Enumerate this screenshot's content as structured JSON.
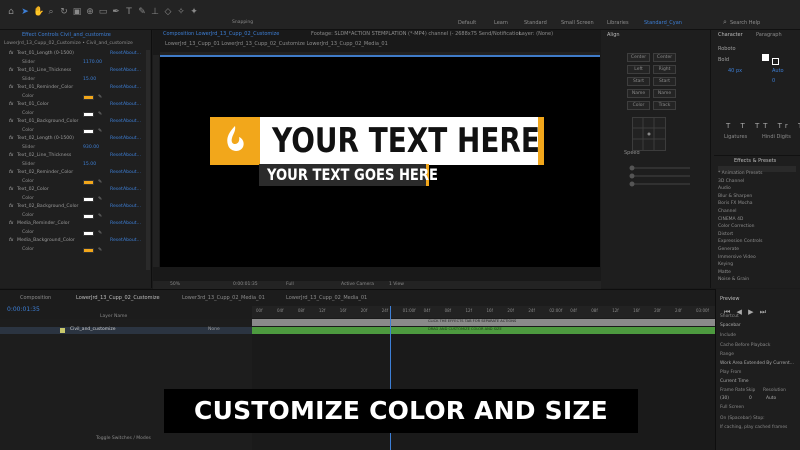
{
  "toolbar": {
    "workspaces": [
      "Default",
      "Learn",
      "Standard",
      "Small Screen",
      "Libraries",
      "Standard_Cyan"
    ],
    "snapping": "Snapping",
    "search": "Search Help"
  },
  "effect_controls": {
    "tab": "Effect Controls Civil_and_customize",
    "layer": "LowerJrd_13_Cupp_02_Customize • Civil_and_customize",
    "rows": [
      {
        "label": "Text_01_Length (0-1500)",
        "reset": "Reset",
        "about": "About..."
      },
      {
        "sub": "Slider",
        "value": "1170.00"
      },
      {
        "label": "Text_01_Line_Thickness",
        "reset": "Reset",
        "about": "About..."
      },
      {
        "sub": "Slider",
        "value": "15.00"
      },
      {
        "label": "Text_01_Reminder_Color",
        "reset": "Reset",
        "about": "About..."
      },
      {
        "sub": "Color",
        "swatch": "#f2a71b"
      },
      {
        "label": "Text_01_Color",
        "reset": "Reset",
        "about": "About..."
      },
      {
        "sub": "Color",
        "swatch": "#ffffff"
      },
      {
        "label": "Text_01_Background_Color",
        "reset": "Reset",
        "about": "About..."
      },
      {
        "sub": "Color",
        "swatch": "#ffffff"
      },
      {
        "label": "Text_02_Length (0-1500)",
        "reset": "Reset",
        "about": "About..."
      },
      {
        "sub": "Slider",
        "value": "930.00"
      },
      {
        "label": "Text_02_Line_Thickness",
        "reset": "Reset",
        "about": "About..."
      },
      {
        "sub": "Slider",
        "value": "15.00"
      },
      {
        "label": "Text_02_Reminder_Color",
        "reset": "Reset",
        "about": "About..."
      },
      {
        "sub": "Color",
        "swatch": "#f2a71b"
      },
      {
        "label": "Text_02_Color",
        "reset": "Reset",
        "about": "About..."
      },
      {
        "sub": "Color",
        "swatch": "#ffffff"
      },
      {
        "label": "Text_02_Background_Color",
        "reset": "Reset",
        "about": "About..."
      },
      {
        "sub": "Color",
        "swatch": "#ffffff"
      },
      {
        "label": "Media_Reminder_Color",
        "reset": "Reset",
        "about": "About..."
      },
      {
        "sub": "Color",
        "swatch": "#ffffff"
      },
      {
        "label": "Media_Background_Color",
        "reset": "Reset",
        "about": "About..."
      },
      {
        "sub": "Color",
        "swatch": "#f2a71b"
      }
    ]
  },
  "composition": {
    "tab": "Composition LowerJrd_13_Cupp_02_Customize",
    "footage_tab": "Footage: SLDM*ACTION STEMPLATION (*-MP4) channel (- 2688x75 Send/Notification",
    "layer_tab": "Layer: (None)",
    "breadcrumb": "LowerJrd_13_Cupp_01    LowerJrd_13_Cupp_02_Customize    LowerJrd_13_Cupp_02_Media_01",
    "zoom": "50%",
    "timecode": "0:00:01:35",
    "resolution": "Full",
    "camera": "Active Camera",
    "view": "1 View"
  },
  "lower_third": {
    "title": "YOUR TEXT HERE",
    "subtitle": "YOUR TEXT GOES HERE"
  },
  "align": {
    "title": "Align",
    "grid": [
      "Center",
      "Center",
      "Left",
      "Right",
      "Start",
      "Start",
      "Name",
      "Name",
      "Color",
      "Track"
    ],
    "speed_title": "Speed"
  },
  "character": {
    "tabs": [
      "Character",
      "Paragraph"
    ],
    "font": "Roboto",
    "style": "Bold",
    "size": "40 px",
    "leading": "Auto",
    "tracking": "0",
    "options": [
      "Ligatures",
      "Hindi Digits"
    ]
  },
  "effects_presets": {
    "title": "Effects & Presets",
    "items": [
      "* Animation Presets",
      "3D Channel",
      "Audio",
      "Blur & Sharpen",
      "Boris FX Mocha",
      "Channel",
      "CINEMA 4D",
      "Color Correction",
      "Distort",
      "Expression Controls",
      "Generate",
      "Immersive Video",
      "Keying",
      "Matte",
      "Noise & Grain"
    ]
  },
  "timeline": {
    "tabs": [
      "Composition",
      "LowerJrd_13_Cupp_02_Customize",
      "Lower3rd_13_Cupp_02_Media_01",
      "LowerJrd_13_Cupp_02_Media_01"
    ],
    "timecode": "0:00:01:35",
    "layer_name": "Civil_and_customize",
    "mode": "None",
    "ruler_ticks": [
      "00f",
      "04f",
      "08f",
      "12f",
      "16f",
      "20f",
      "24f",
      "01:00f",
      "04f",
      "08f",
      "12f",
      "16f",
      "20f",
      "24f",
      "02:00f",
      "04f",
      "08f",
      "12f",
      "16f",
      "20f",
      "24f",
      "03:00f"
    ],
    "track_note_1": "CLICK THE EFFECTS TAB FOR SEPARATE ACTIONS",
    "track_note_2": "DRAG AND CUSTOMIZE COLOR AND SIZE",
    "footer": "Toggle Switches / Modes"
  },
  "preview": {
    "title": "Preview",
    "shortcut_label": "Shortcut",
    "shortcut": "Spacebar",
    "include_label": "Include",
    "cache": "Cache Before Playback",
    "range_label": "Range",
    "range": "Work Area Extended By Current...",
    "play_from_label": "Play From",
    "play_from": "Current Time",
    "frame_rate_label": "Frame Rate",
    "skip_label": "Skip",
    "resolution_label": "Resolution",
    "frame_rate": "(30)",
    "skip": "0",
    "res": "Auto",
    "full_screen": "Full Screen",
    "on_stop": "On (Spacebar) Stop:",
    "if_caching": "If caching, play cached frames"
  },
  "caption": "CUSTOMIZE COLOR AND SIZE"
}
